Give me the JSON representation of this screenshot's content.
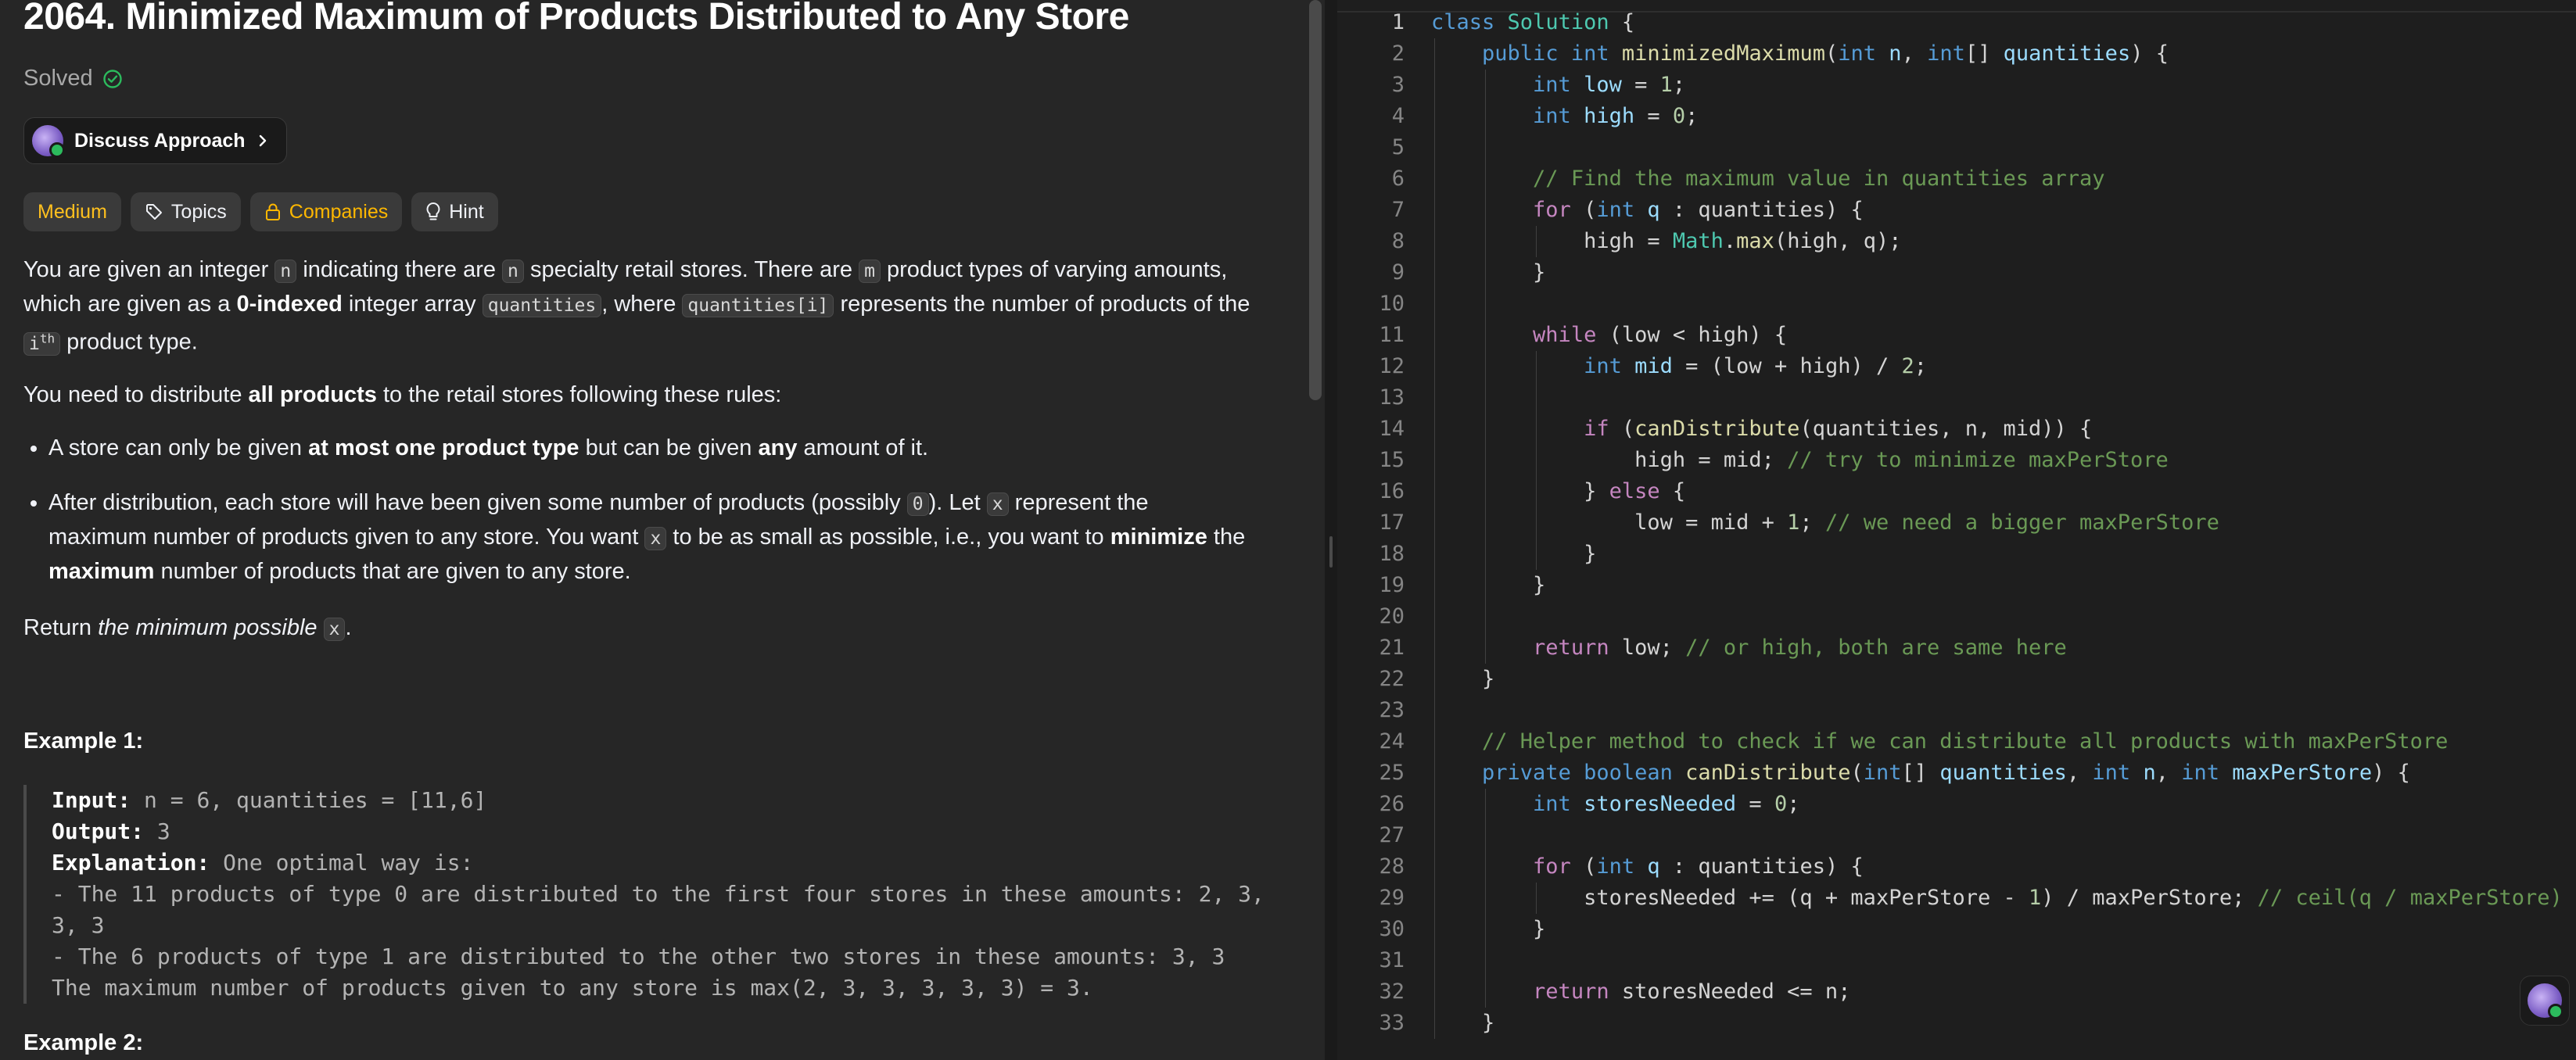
{
  "problem": {
    "title": "2064. Minimized Maximum of Products Distributed to Any Store",
    "status": "Solved",
    "discuss_label": "Discuss Approach",
    "tags": {
      "difficulty": "Medium",
      "topics": "Topics",
      "companies": "Companies",
      "hint": "Hint"
    },
    "colors": {
      "difficulty": "#ffc01e",
      "solved_check": "#2cbb5d",
      "companies": "#ffb800"
    },
    "desc1": {
      "t1": "You are given an integer ",
      "c1": "n",
      "t2": " indicating there are ",
      "c2": "n",
      "t3": " specialty retail stores. There are ",
      "c3": "m",
      "t4": " product types of varying amounts,",
      "t5": "which are given as a ",
      "b1": "0-indexed",
      "t6": " integer array ",
      "c4": "quantities",
      "t7": ", where ",
      "c5": "quantities[i]",
      "t8": " represents the number of products of the",
      "c6": "i",
      "sup": "th",
      "t9": " product type."
    },
    "desc2": {
      "t1": "You need to distribute ",
      "b1": "all products",
      "t2": " to the retail stores following these rules:"
    },
    "rule1": {
      "t1": "A store can only be given ",
      "b1": "at most one product type",
      "t2": " but can be given ",
      "b2": "any",
      "t3": " amount of it."
    },
    "rule2": {
      "t1": "After distribution, each store will have been given some number of products (possibly ",
      "c1": "0",
      "t2": "). Let ",
      "c2": "x",
      "t3": " represent the",
      "t4": "maximum number of products given to any store. You want ",
      "c3": "x",
      "t5": " to be as small as possible, i.e., you want to ",
      "b1": "minimize",
      "t6": " the",
      "b2": "maximum",
      "t7": " number of products that are given to any store."
    },
    "ret": {
      "t1": "Return ",
      "i1": "the minimum possible ",
      "c1": "x",
      "t2": "."
    },
    "example1": {
      "heading": "Example 1:",
      "input_label": "Input:",
      "input": " n = 6, quantities = [11,6]",
      "output_label": "Output:",
      "output": " 3",
      "explanation_label": "Explanation:",
      "explanation": " One optimal way is:",
      "line1": "- The 11 products of type 0 are distributed to the first four stores in these amounts: 2, 3,",
      "line1b": "3, 3",
      "line2": "- The 6 products of type 1 are distributed to the other two stores in these amounts: 3, 3",
      "line3": "The maximum number of products given to any store is max(2, 3, 3, 3, 3, 3) = 3."
    },
    "example2": {
      "heading": "Example 2:"
    }
  },
  "editor": {
    "active_line": 1,
    "lines": [
      "class Solution {",
      "    public int minimizedMaximum(int n, int[] quantities) {",
      "        int low = 1;",
      "        int high = 0;",
      "",
      "        // Find the maximum value in quantities array",
      "        for (int q : quantities) {",
      "            high = Math.max(high, q);",
      "        }",
      "",
      "        while (low < high) {",
      "            int mid = (low + high) / 2;",
      "",
      "            if (canDistribute(quantities, n, mid)) {",
      "                high = mid; // try to minimize maxPerStore",
      "            } else {",
      "                low = mid + 1; // we need a bigger maxPerStore",
      "            }",
      "        }",
      "",
      "        return low; // or high, both are same here",
      "    }",
      "",
      "    // Helper method to check if we can distribute all products with maxPerStore",
      "    private boolean canDistribute(int[] quantities, int n, int maxPerStore) {",
      "        int storesNeeded = 0;",
      "",
      "        for (int q : quantities) {",
      "            storesNeeded += (q + maxPerStore - 1) / maxPerStore; // ceil(q / maxPerStore)",
      "        }",
      "",
      "        return storesNeeded <= n;",
      "    }"
    ]
  }
}
